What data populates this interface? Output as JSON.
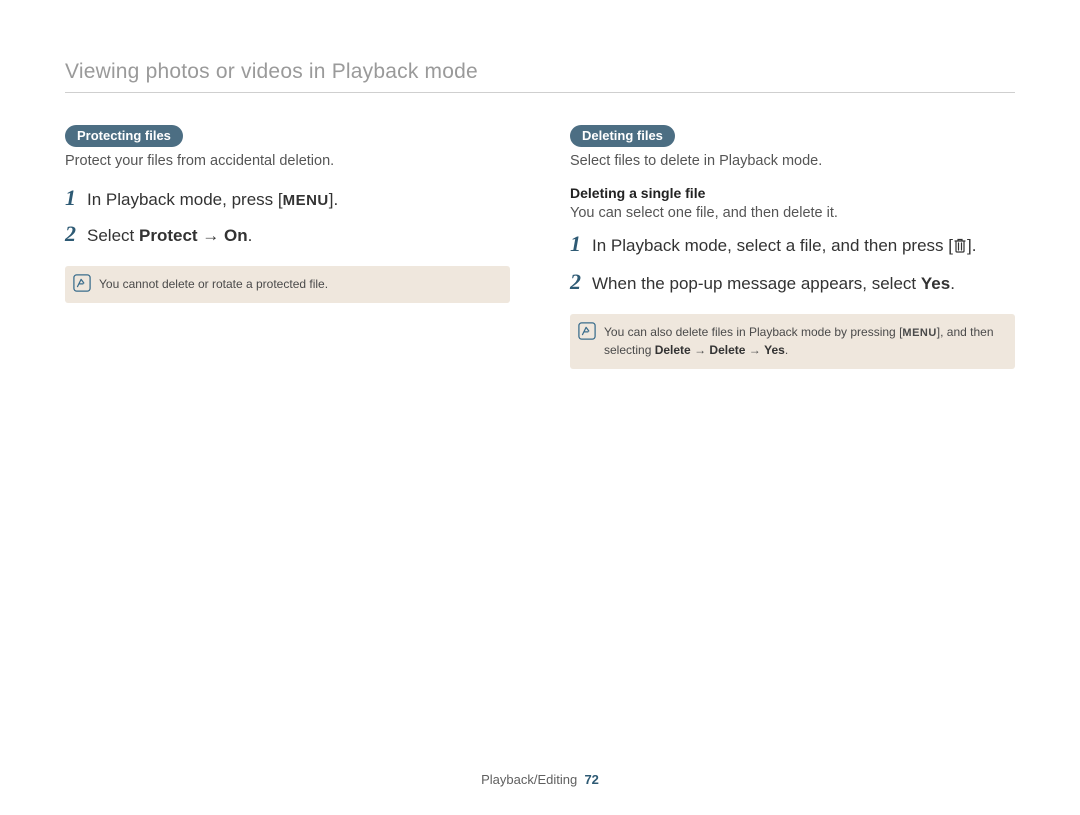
{
  "header": {
    "title": "Viewing photos or videos in Playback mode"
  },
  "left": {
    "pill": "Protecting files",
    "intro": "Protect your files from accidental deletion.",
    "steps": [
      {
        "num": "1",
        "pre": "In Playback mode, press [",
        "icon": "MENU",
        "post": "]."
      },
      {
        "num": "2",
        "pre": "Select ",
        "bold1": "Protect",
        "arrow": " → ",
        "bold2": "On",
        "post": "."
      }
    ],
    "note": "You cannot delete or rotate a protected file."
  },
  "right": {
    "pill": "Deleting files",
    "intro": "Select files to delete in Playback mode.",
    "sub": {
      "title": "Deleting a single file",
      "desc": "You can select one file, and then delete it."
    },
    "steps": [
      {
        "num": "1",
        "pre": "In Playback mode, select a file, and then press [",
        "icon": "trash",
        "post": "]."
      },
      {
        "num": "2",
        "pre": "When the pop-up message appears, select ",
        "bold1": "Yes",
        "post": "."
      }
    ],
    "note": {
      "t1": "You can also delete files in Playback mode by pressing [",
      "menu": "MENU",
      "t2": "], and then selecting ",
      "b1": "Delete",
      "arr1": " → ",
      "b2": "Delete",
      "arr2": " → ",
      "b3": "Yes",
      "t3": "."
    }
  },
  "footer": {
    "section": "Playback/Editing",
    "page": "72"
  }
}
